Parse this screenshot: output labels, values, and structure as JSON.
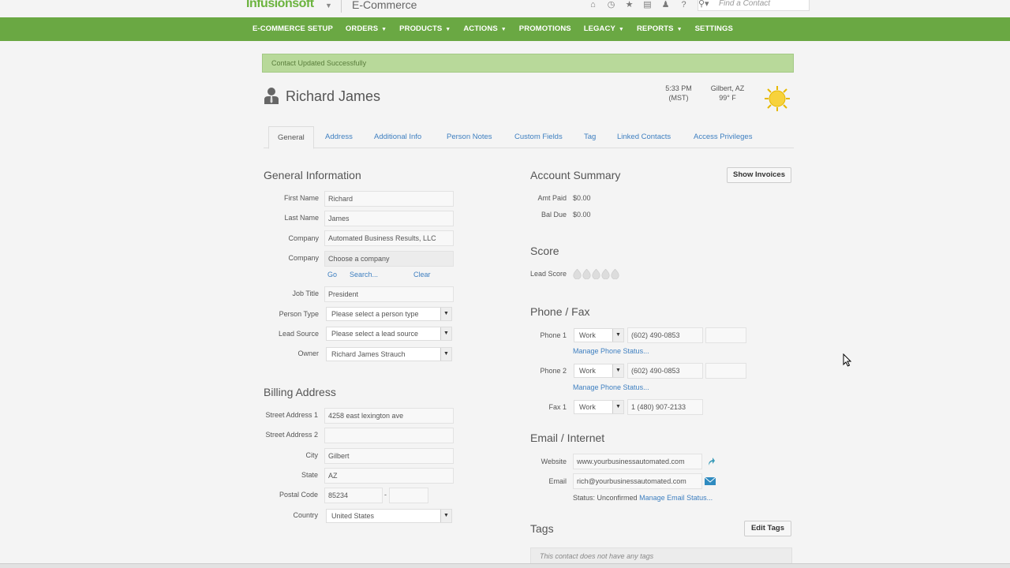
{
  "brand": {
    "logo": "Infusionsoft",
    "app_name": "E-Commerce"
  },
  "top_icons": [
    "home-icon",
    "clock-icon",
    "star-icon",
    "list-icon",
    "user-icon",
    "help-icon"
  ],
  "search": {
    "placeholder": "Find a Contact"
  },
  "nav": [
    {
      "label": "E-COMMERCE SETUP",
      "dropdown": false
    },
    {
      "label": "ORDERS",
      "dropdown": true
    },
    {
      "label": "PRODUCTS",
      "dropdown": true
    },
    {
      "label": "ACTIONS",
      "dropdown": true
    },
    {
      "label": "PROMOTIONS",
      "dropdown": false
    },
    {
      "label": "LEGACY",
      "dropdown": true
    },
    {
      "label": "REPORTS",
      "dropdown": true
    },
    {
      "label": "SETTINGS",
      "dropdown": false
    }
  ],
  "alert": "Contact Updated Successfully",
  "contact": {
    "name": "Richard James"
  },
  "time": {
    "line1": "5:33 PM",
    "line2": "(MST)"
  },
  "weather": {
    "line1": "Gilbert, AZ",
    "line2": "99° F"
  },
  "tabs": [
    "General",
    "Address",
    "Additional Info",
    "Person Notes",
    "Custom Fields",
    "Tag",
    "Linked Contacts",
    "Access Privileges"
  ],
  "general": {
    "title": "General Information",
    "first_name_label": "First Name",
    "first_name": "Richard",
    "last_name_label": "Last Name",
    "last_name": "James",
    "company_label": "Company",
    "company": "Automated Business Results, LLC",
    "company2_label": "Company",
    "company2": "Choose a company",
    "go": "Go",
    "search": "Search...",
    "clear": "Clear",
    "job_title_label": "Job Title",
    "job_title": "President",
    "person_type_label": "Person Type",
    "person_type": "Please select a person type",
    "lead_source_label": "Lead Source",
    "lead_source": "Please select a lead source",
    "owner_label": "Owner",
    "owner": "Richard James Strauch"
  },
  "billing": {
    "title": "Billing Address",
    "street1_label": "Street Address 1",
    "street1": "4258 east lexington ave",
    "street2_label": "Street Address 2",
    "street2": "",
    "city_label": "City",
    "city": "Gilbert",
    "state_label": "State",
    "state": "AZ",
    "postal_label": "Postal Code",
    "postal": "85234",
    "postal_sep": "-",
    "postal_ext": "",
    "country_label": "Country",
    "country": "United States"
  },
  "account": {
    "title": "Account Summary",
    "show_invoices": "Show Invoices",
    "amt_paid_label": "Amt Paid",
    "amt_paid": "$0.00",
    "bal_due_label": "Bal Due",
    "bal_due": "$0.00"
  },
  "score": {
    "title": "Score",
    "lead_score_label": "Lead Score",
    "lead_score": 0
  },
  "phone": {
    "title": "Phone / Fax",
    "phone1_label": "Phone 1",
    "phone1_type": "Work",
    "phone1": "(602) 490-0853",
    "phone1_ext": "",
    "manage1": "Manage Phone Status...",
    "phone2_label": "Phone 2",
    "phone2_type": "Work",
    "phone2": "(602) 490-0853",
    "phone2_ext": "",
    "manage2": "Manage Phone Status...",
    "fax1_label": "Fax 1",
    "fax1_type": "Work",
    "fax1": "1 (480) 907-2133"
  },
  "email": {
    "title": "Email / Internet",
    "website_label": "Website",
    "website": "www.yourbusinessautomated.com",
    "email_label": "Email",
    "email": "rich@yourbusinessautomated.com",
    "status_label": "Status:",
    "status": "Unconfirmed",
    "manage": "Manage Email Status..."
  },
  "tags": {
    "title": "Tags",
    "edit": "Edit Tags",
    "empty": "This contact does not have any tags"
  },
  "colors": {
    "nav": "#6aa843",
    "link": "#3e7fc0",
    "alert": "#b8d99a"
  }
}
